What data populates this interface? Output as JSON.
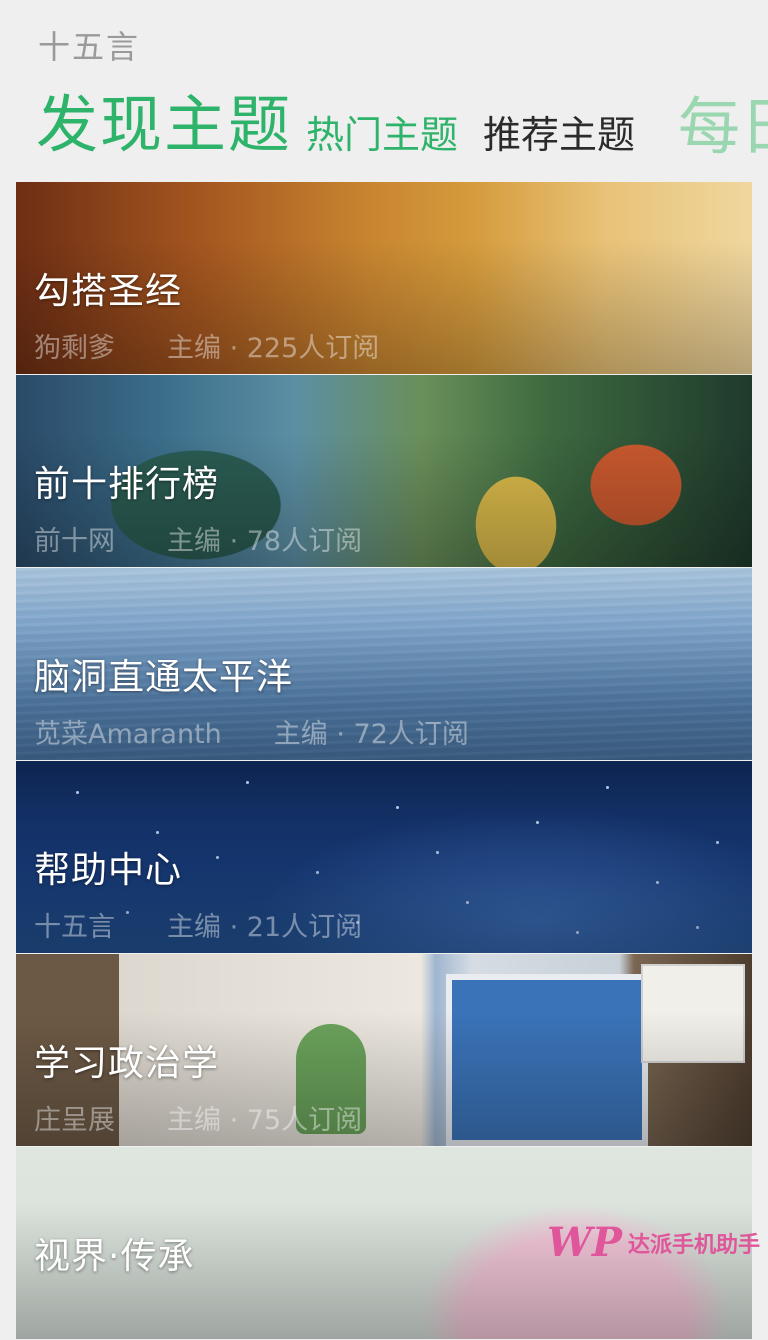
{
  "app": {
    "name": "十五言"
  },
  "pivot": {
    "current": "发现主题",
    "tabs": [
      "热门主题",
      "推荐主题",
      "每日"
    ]
  },
  "topics": [
    {
      "title": "勾搭圣经",
      "editor": "狗剩爹",
      "meta": "主编 · 225人订阅"
    },
    {
      "title": "前十排行榜",
      "editor": "前十网",
      "meta": "主编 · 78人订阅"
    },
    {
      "title": "脑洞直通太平洋",
      "editor": "苋菜Amaranth",
      "meta": "主编 · 72人订阅"
    },
    {
      "title": "帮助中心",
      "editor": "十五言",
      "meta": "主编 · 21人订阅"
    },
    {
      "title": "学习政治学",
      "editor": "庄呈展",
      "meta": "主编 · 75人订阅"
    },
    {
      "title": "视界·传承",
      "editor": "",
      "meta": ""
    }
  ],
  "watermark": {
    "logo": "WP",
    "text": "达派手机助手"
  },
  "colors": {
    "accent": "#2db36a",
    "accent_faded": "#9ad6b0",
    "watermark": "#e0569a"
  }
}
